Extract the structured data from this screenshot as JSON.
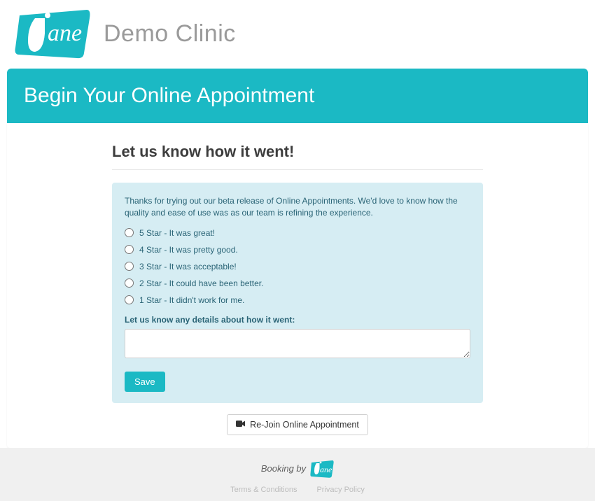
{
  "header": {
    "clinic_name": "Demo Clinic"
  },
  "banner": {
    "title": "Begin Your Online Appointment"
  },
  "feedback": {
    "section_title": "Let us know how it went!",
    "intro": "Thanks for trying out our beta release of Online Appointments. We'd love to know how the quality and ease of use was as our team is refining the experience.",
    "options": [
      "5 Star - It was great!",
      "4 Star - It was pretty good.",
      "3 Star - It was acceptable!",
      "2 Star - It could have been better.",
      "1 Star - It didn't work for me."
    ],
    "details_label": "Let us know any details about how it went:",
    "save_label": "Save"
  },
  "rejoin": {
    "label": "Re-Join Online Appointment"
  },
  "footer": {
    "booking_by": "Booking by",
    "terms": "Terms & Conditions",
    "privacy": "Privacy Policy"
  },
  "colors": {
    "brand": "#1bb9c4",
    "panel": "#d6edf3"
  }
}
